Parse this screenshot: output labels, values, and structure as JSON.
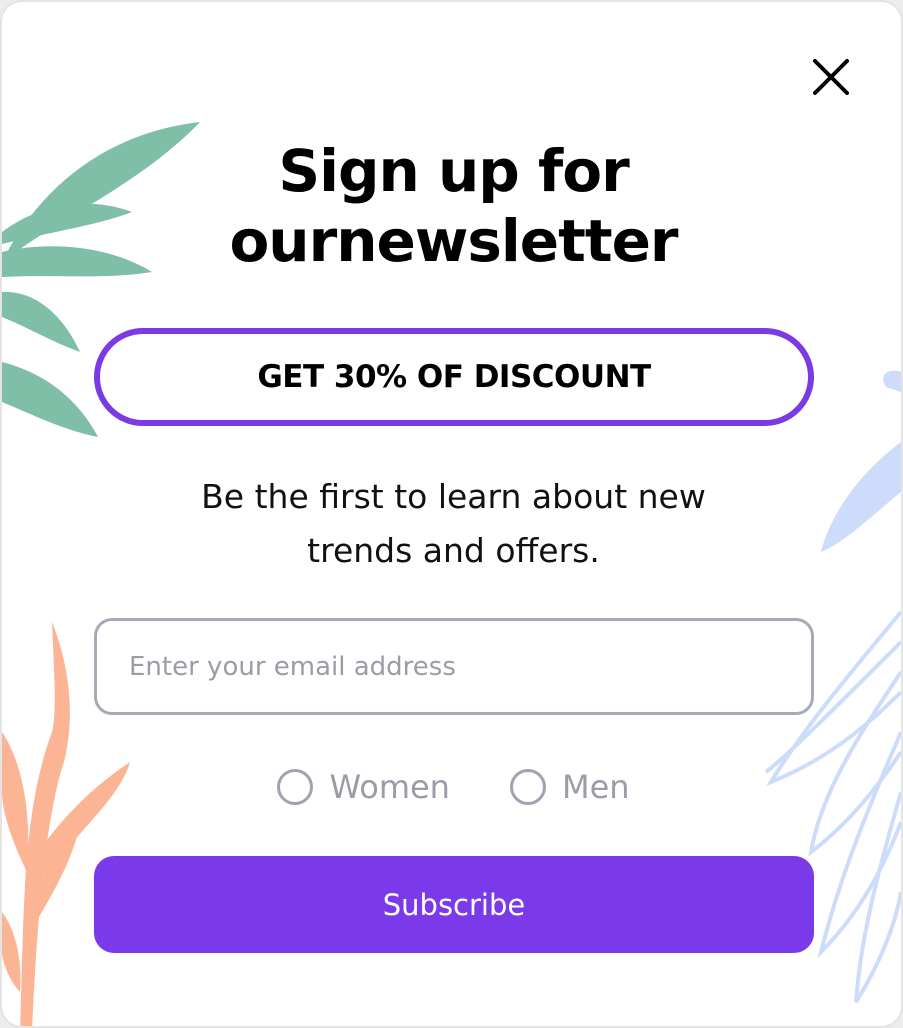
{
  "popup": {
    "title_line1": "Sign up for",
    "title_line2": "ournewsletter",
    "discount_badge": "GET 30% OF DISCOUNT",
    "subtitle_line1": "Be the first to learn about new",
    "subtitle_line2": "trends and offers.",
    "email_placeholder": "Enter your email address",
    "email_value": "",
    "radio_options": [
      {
        "label": "Women",
        "checked": false
      },
      {
        "label": "Men",
        "checked": false
      }
    ],
    "subscribe_label": "Subscribe",
    "close_icon": "close-icon"
  },
  "colors": {
    "accent": "#7b3ae9",
    "leaf_green": "#7fbfa8",
    "leaf_orange": "#fcb594",
    "leaf_blue": "#cddcfb",
    "input_border": "#a7aab5"
  }
}
